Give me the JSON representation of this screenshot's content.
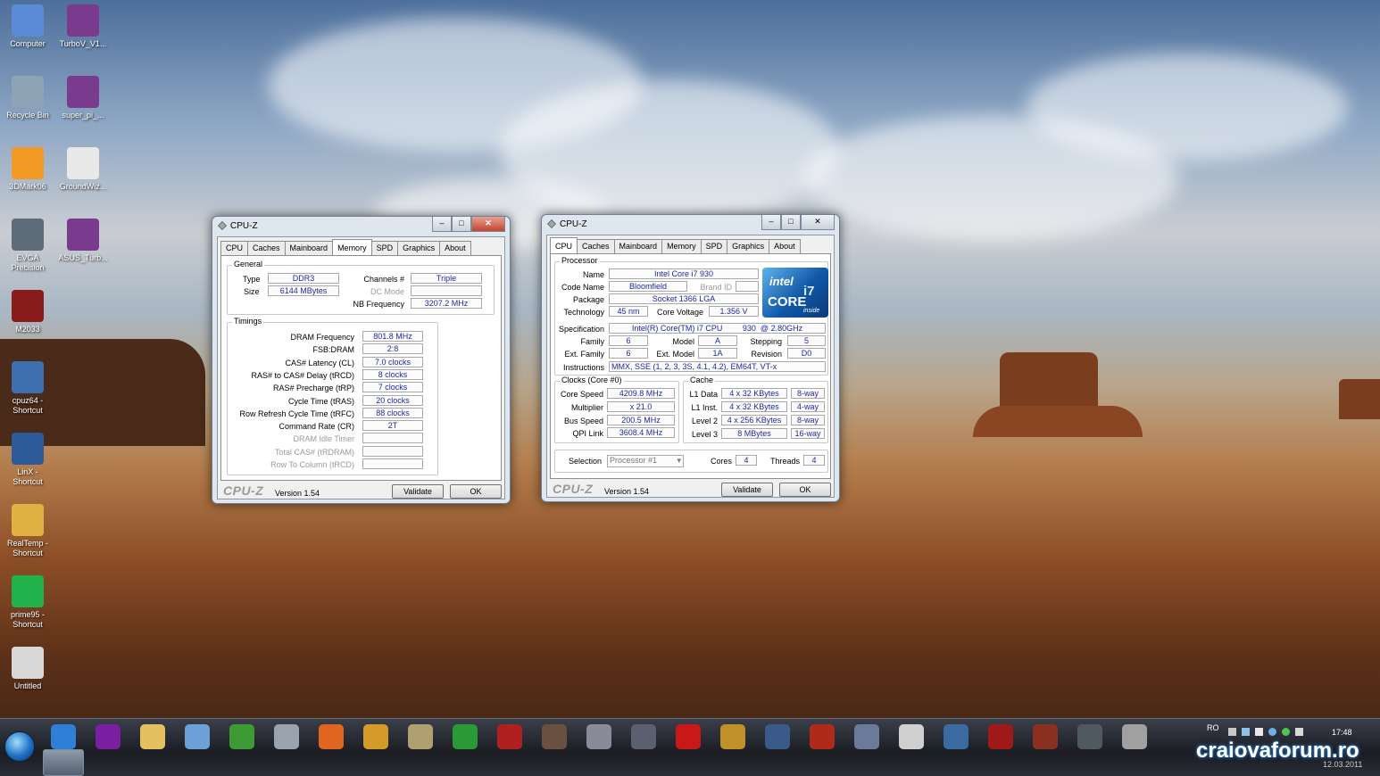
{
  "desktop": {
    "icons": [
      {
        "label": "Computer",
        "icon": "computer-icon",
        "color": "#5b8bd6"
      },
      {
        "label": "TurboV_V1...",
        "icon": "winrar-archive-icon",
        "color": "#7a3b8f"
      },
      {
        "label": "Recycle Bin",
        "icon": "recycle-bin-icon",
        "color": "#8fa3b6"
      },
      {
        "label": "super_pi_...",
        "icon": "winrar-archive-icon",
        "color": "#7a3b8f"
      },
      {
        "label": "3DMark06",
        "icon": "3dmark-icon",
        "color": "#f29a23"
      },
      {
        "label": "GroundWiz...",
        "icon": "groundwiz-icon",
        "color": "#e8e8e8"
      },
      {
        "label": "EVGA\nPrecision",
        "icon": "evga-precision-icon",
        "color": "#5e6c7a"
      },
      {
        "label": "ASUS_Turb...",
        "icon": "winrar-archive-icon",
        "color": "#7a3b8f"
      },
      {
        "label": "M2033",
        "icon": "m2033-icon",
        "color": "#8a1b1b"
      },
      {
        "label": "cpuz64 -\nShortcut",
        "icon": "cpuz-icon",
        "color": "#3d6fb0"
      },
      {
        "label": "LinX -\nShortcut",
        "icon": "linx-icon",
        "color": "#2d5b9a"
      },
      {
        "label": "RealTemp -\nShortcut",
        "icon": "realtemp-icon",
        "color": "#e0b243"
      },
      {
        "label": "prime95 -\nShortcut",
        "icon": "prime95-icon",
        "color": "#22b24c"
      },
      {
        "label": "Untitled",
        "icon": "image-file-icon",
        "color": "#d8d8d8"
      }
    ]
  },
  "cpuz_memory": {
    "title": "CPU-Z",
    "tabs": [
      "CPU",
      "Caches",
      "Mainboard",
      "Memory",
      "SPD",
      "Graphics",
      "About"
    ],
    "active_tab": "Memory",
    "general_title": "General",
    "type_label": "Type",
    "type_value": "DDR3",
    "size_label": "Size",
    "size_value": "6144 MBytes",
    "channels_label": "Channels #",
    "channels_value": "Triple",
    "dcmode_label": "DC Mode",
    "dcmode_value": "",
    "nbfreq_label": "NB Frequency",
    "nbfreq_value": "3207.2 MHz",
    "timings_title": "Timings",
    "timings": [
      {
        "label": "DRAM Frequency",
        "value": "801.8 MHz",
        "disabled": false
      },
      {
        "label": "FSB:DRAM",
        "value": "2:8",
        "disabled": false
      },
      {
        "label": "CAS# Latency (CL)",
        "value": "7.0 clocks",
        "disabled": false
      },
      {
        "label": "RAS# to CAS# Delay (tRCD)",
        "value": "8 clocks",
        "disabled": false
      },
      {
        "label": "RAS# Precharge (tRP)",
        "value": "7 clocks",
        "disabled": false
      },
      {
        "label": "Cycle Time (tRAS)",
        "value": "20 clocks",
        "disabled": false
      },
      {
        "label": "Row Refresh Cycle Time (tRFC)",
        "value": "88 clocks",
        "disabled": false
      },
      {
        "label": "Command Rate (CR)",
        "value": "2T",
        "disabled": false
      },
      {
        "label": "DRAM Idle Timer",
        "value": "",
        "disabled": true
      },
      {
        "label": "Total CAS# (tRDRAM)",
        "value": "",
        "disabled": true
      },
      {
        "label": "Row To Column (tRCD)",
        "value": "",
        "disabled": true
      }
    ],
    "brand": "CPU-Z",
    "version": "Version 1.54",
    "validate_label": "Validate",
    "ok_label": "OK"
  },
  "cpuz_cpu": {
    "title": "CPU-Z",
    "tabs": [
      "CPU",
      "Caches",
      "Mainboard",
      "Memory",
      "SPD",
      "Graphics",
      "About"
    ],
    "active_tab": "CPU",
    "processor_title": "Processor",
    "name_label": "Name",
    "name_value": "Intel Core i7 930",
    "codename_label": "Code Name",
    "codename_value": "Bloomfield",
    "brandid_label": "Brand ID",
    "brandid_value": "",
    "package_label": "Package",
    "package_value": "Socket 1366 LGA",
    "technology_label": "Technology",
    "technology_value": "45 nm",
    "voltage_label": "Core Voltage",
    "voltage_value": "1.356 V",
    "spec_label": "Specification",
    "spec_value": "Intel(R) Core(TM) i7 CPU         930  @ 2.80GHz",
    "family_label": "Family",
    "family_value": "6",
    "model_label": "Model",
    "model_value": "A",
    "stepping_label": "Stepping",
    "stepping_value": "5",
    "extfamily_label": "Ext. Family",
    "extfamily_value": "6",
    "extmodel_label": "Ext. Model",
    "extmodel_value": "1A",
    "revision_label": "Revision",
    "revision_value": "D0",
    "instr_label": "Instructions",
    "instr_value": "MMX, SSE (1, 2, 3, 3S, 4.1, 4.2), EM64T, VT-x",
    "logo": {
      "line1": "intel",
      "line2": "CORE",
      "line3": "i7",
      "line4": "inside"
    },
    "clocks_title": "Clocks (Core #0)",
    "corespeed_label": "Core Speed",
    "corespeed_value": "4209.8 MHz",
    "multiplier_label": "Multiplier",
    "multiplier_value": "x 21.0",
    "busspeed_label": "Bus Speed",
    "busspeed_value": "200.5 MHz",
    "qpi_label": "QPI Link",
    "qpi_value": "3608.4 MHz",
    "cache_title": "Cache",
    "cache": [
      {
        "label": "L1 Data",
        "size": "4 x 32 KBytes",
        "ways": "8-way"
      },
      {
        "label": "L1 Inst.",
        "size": "4 x 32 KBytes",
        "ways": "4-way"
      },
      {
        "label": "Level 2",
        "size": "4 x 256 KBytes",
        "ways": "8-way"
      },
      {
        "label": "Level 3",
        "size": "8 MBytes",
        "ways": "16-way"
      }
    ],
    "selection_label": "Selection",
    "selection_value": "Processor #1",
    "cores_label": "Cores",
    "cores_value": "4",
    "threads_label": "Threads",
    "threads_value": "4",
    "brand": "CPU-Z",
    "version": "Version 1.54",
    "validate_label": "Validate",
    "ok_label": "OK"
  },
  "taskbar": {
    "start": "windows-start-orb-icon",
    "apps": [
      {
        "icon": "internet-explorer-icon",
        "color": "#2f7fd6"
      },
      {
        "icon": "yahoo-messenger-icon",
        "color": "#7b1fa2"
      },
      {
        "icon": "windows-explorer-icon",
        "color": "#e4c060"
      },
      {
        "icon": "media-player-icon",
        "color": "#6ea0d8"
      },
      {
        "icon": "utorrent-icon",
        "color": "#3e9a34"
      },
      {
        "icon": "network-globe-icon",
        "color": "#9aa3b0"
      },
      {
        "icon": "firefox-icon",
        "color": "#e0661f"
      },
      {
        "icon": "app-orb-icon",
        "color": "#d49a2a"
      },
      {
        "icon": "lightning-app-icon",
        "color": "#b0a070"
      },
      {
        "icon": "game-2-icon",
        "color": "#2a9a36"
      },
      {
        "icon": "game-red-2-icon",
        "color": "#b02020"
      },
      {
        "icon": "game-portrait-icon",
        "color": "#6a5040"
      },
      {
        "icon": "game-character-icon",
        "color": "#8a8a9a"
      },
      {
        "icon": "game-soldier-icon",
        "color": "#5a6070"
      },
      {
        "icon": "game-red-logo-icon",
        "color": "#c81818"
      },
      {
        "icon": "warcraft-icon",
        "color": "#c0902a"
      },
      {
        "icon": "game-blue-icon",
        "color": "#3a5a8a"
      },
      {
        "icon": "game-dragon-icon",
        "color": "#b02a1a"
      },
      {
        "icon": "game-fallout-icon",
        "color": "#6a7a9a"
      },
      {
        "icon": "game-z-icon",
        "color": "#d0d0d0"
      },
      {
        "icon": "game-disc-icon",
        "color": "#3a6aa0"
      },
      {
        "icon": "game-h-icon",
        "color": "#a01818"
      },
      {
        "icon": "game-emblem-icon",
        "color": "#8a3020"
      },
      {
        "icon": "game-helmet-icon",
        "color": "#505860"
      },
      {
        "icon": "game-grey-icon",
        "color": "#a0a0a0"
      }
    ],
    "open_window_icon": "cpuz-taskbar-icon",
    "lang": "RO",
    "time": "17:48",
    "date": "12.03.2011",
    "watermark": "craiovaforum.ro"
  }
}
